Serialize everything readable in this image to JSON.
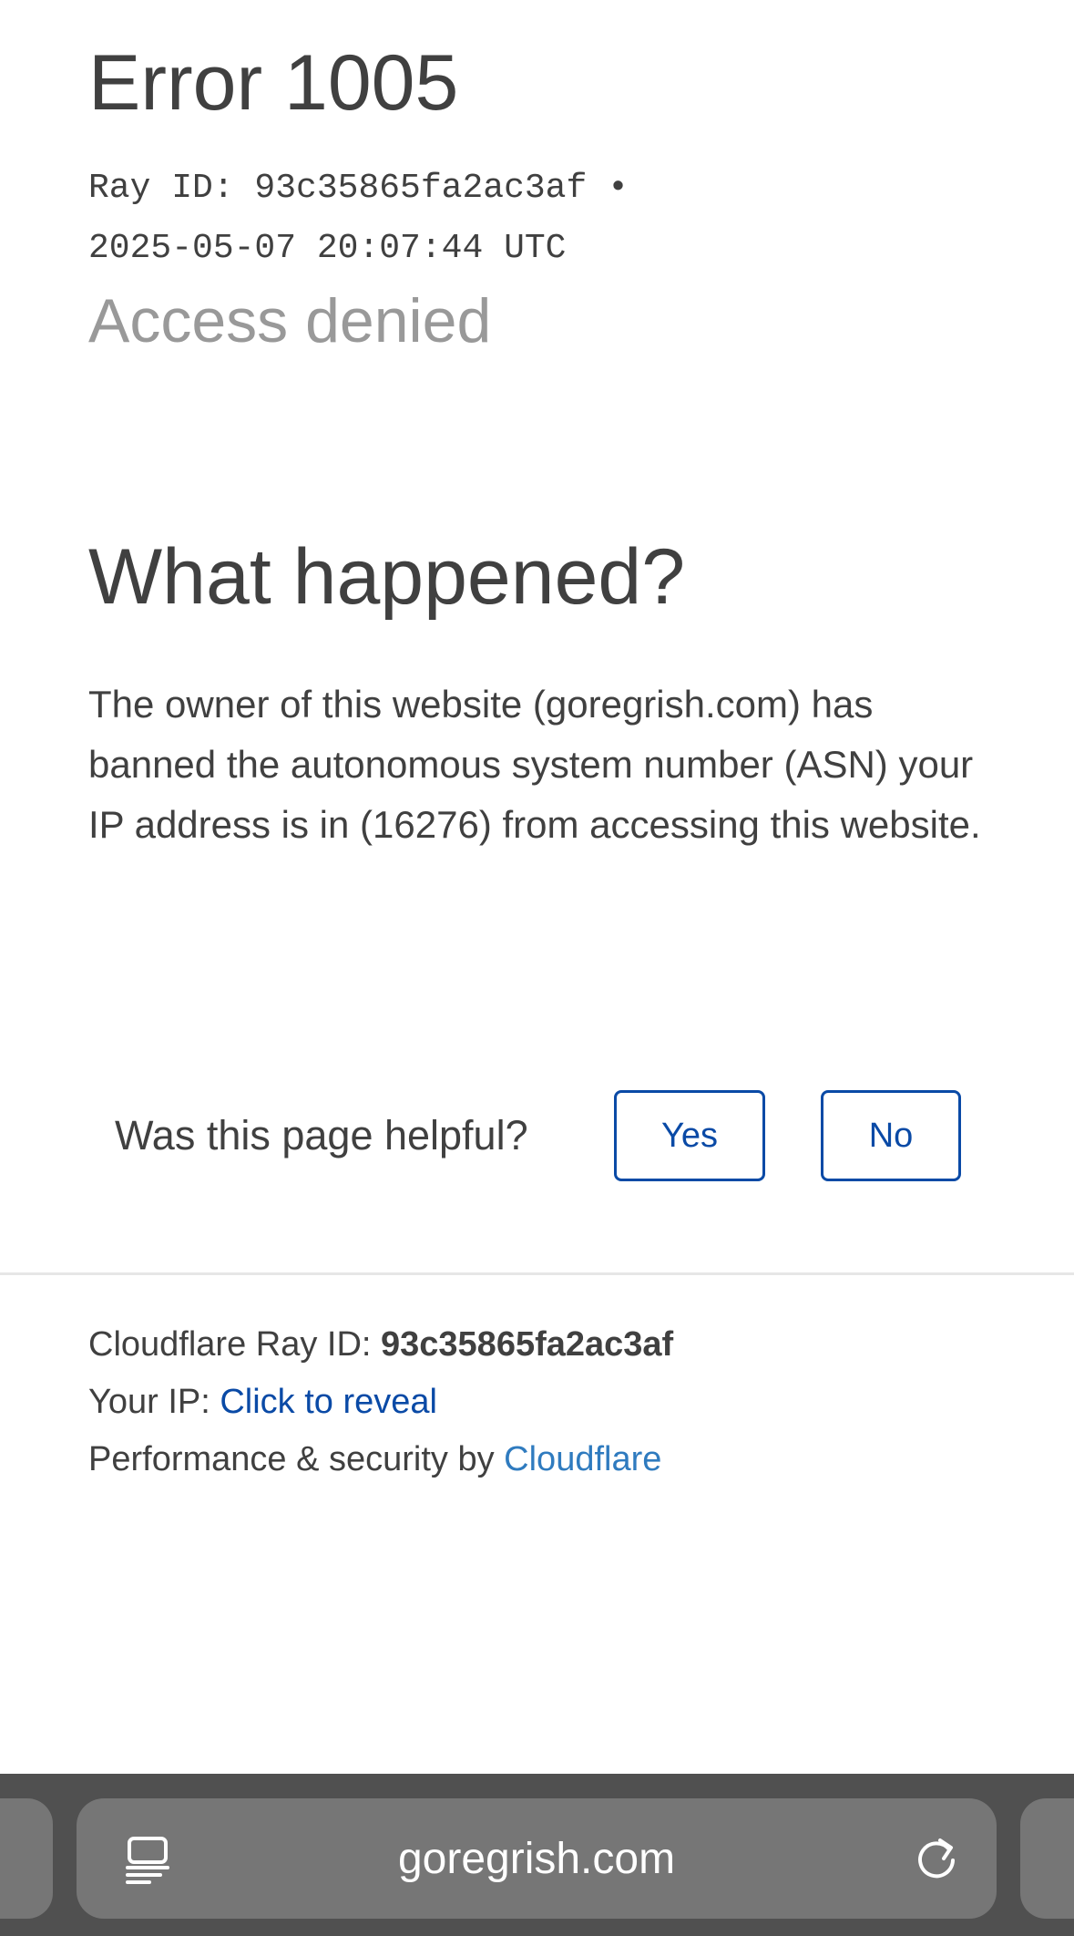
{
  "error": {
    "title": "Error 1005",
    "ray_line_1": "Ray ID: 93c35865fa2ac3af •",
    "ray_line_2": "2025-05-07 20:07:44 UTC",
    "subtitle": "Access denied"
  },
  "what_happened": {
    "heading": "What happened?",
    "body": "The owner of this website (goregrish.com) has banned the autonomous system number (ASN) your IP address is in (16276) from accessing this website."
  },
  "feedback": {
    "question": "Was this page helpful?",
    "yes_label": "Yes",
    "no_label": "No"
  },
  "footer": {
    "ray_prefix": "Cloudflare Ray ID: ",
    "ray_id": "93c35865fa2ac3af",
    "ip_prefix": "Your IP: ",
    "ip_link": "Click to reveal",
    "perf_prefix": "Performance & security by ",
    "perf_link": "Cloudflare"
  },
  "browser": {
    "url": "goregrish.com",
    "tabs_icon": "tabs-icon",
    "reload_icon": "reload-icon"
  },
  "colors": {
    "text": "#404040",
    "muted": "#999999",
    "button_blue": "#0a4aa6",
    "link_blue": "#2f7bbf",
    "toolbar_bg": "#505050",
    "pill_bg": "#767676"
  }
}
